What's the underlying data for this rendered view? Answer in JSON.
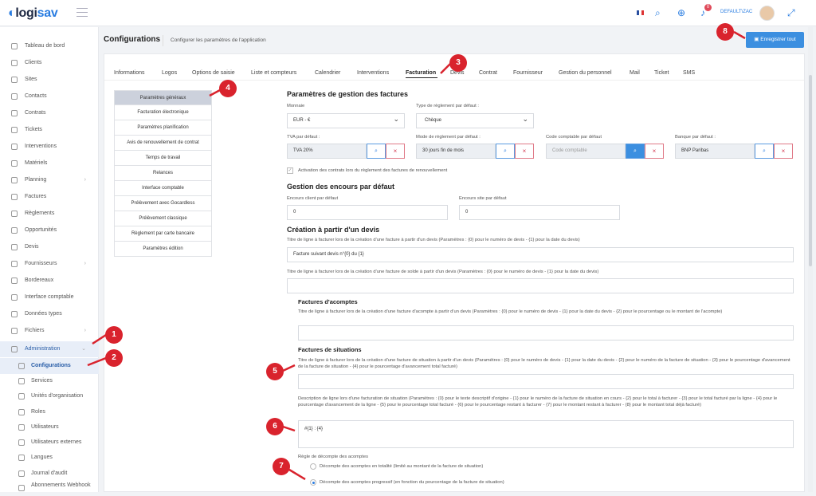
{
  "app": {
    "logo_prefix": "logi",
    "logo_suffix": "sav"
  },
  "topbar": {
    "notification_count": "0",
    "user_label": "DEFAULT\\ZAC"
  },
  "sidebar": {
    "items": [
      {
        "label": "Tableau de bord"
      },
      {
        "label": "Clients"
      },
      {
        "label": "Sites"
      },
      {
        "label": "Contacts"
      },
      {
        "label": "Contrats"
      },
      {
        "label": "Tickets"
      },
      {
        "label": "Interventions"
      },
      {
        "label": "Matériels"
      },
      {
        "label": "Planning"
      },
      {
        "label": "Factures"
      },
      {
        "label": "Règlements"
      },
      {
        "label": "Opportunités"
      },
      {
        "label": "Devis"
      },
      {
        "label": "Fournisseurs"
      },
      {
        "label": "Bordereaux"
      },
      {
        "label": "Interface comptable"
      },
      {
        "label": "Données types"
      },
      {
        "label": "Fichiers"
      },
      {
        "label": "Administration"
      }
    ],
    "sub_items": [
      {
        "label": "Configurations"
      },
      {
        "label": "Services"
      },
      {
        "label": "Unités d'organisation"
      },
      {
        "label": "Roles"
      },
      {
        "label": "Utilisateurs"
      },
      {
        "label": "Utilisateurs externes"
      },
      {
        "label": "Langues"
      },
      {
        "label": "Journal d'audit"
      },
      {
        "label": "Abonnements Webhook"
      }
    ]
  },
  "header": {
    "title": "Configurations",
    "subtitle": "Configurer les paramètres de l'application",
    "save_label": "Enregistrer tout"
  },
  "tabs": [
    "Informations",
    "Logos",
    "Options de saisie",
    "Liste et compteurs",
    "Calendrier",
    "Interventions",
    "Facturation",
    "Devis",
    "Contrat",
    "Fournisseur",
    "Gestion du personnel",
    "Mail",
    "Ticket",
    "SMS"
  ],
  "menu": [
    "Paramètres généraux",
    "Facturation électronique",
    "Paramètres planification",
    "Avis de renouvellement de contrat",
    "Temps de travail",
    "Relances",
    "Interface comptable",
    "Prélèvement avec Gocardless",
    "Prélèvement classique",
    "Règlement par carte bancaire",
    "Paramètres édition"
  ],
  "form": {
    "title": "Paramètres de gestion des factures",
    "monnaie_label": "Monnaie",
    "monnaie_value": "EUR - €",
    "type_reglement_label": "Type de règlement par défaut :",
    "type_reglement_value": "Chèque",
    "tva_label": "TVA par défaut :",
    "tva_value": "TVA 20%",
    "mode_reglement_label": "Mode de règlement par défaut :",
    "mode_reglement_value": "30 jours fin de mois",
    "code_comptable_label": "Code comptable par défaut",
    "code_comptable_placeholder": "Code comptable",
    "banque_label": "Banque par défaut :",
    "banque_value": "BNP Paribas",
    "activation_label": "Activation des contrats lors du règlement des factures de renouvellement",
    "encours_title": "Gestion des encours par défaut",
    "encours_client_label": "Encours client par défaut",
    "encours_client_value": "0",
    "encours_site_label": "Encours site par défaut",
    "encours_site_value": "0",
    "devis_title": "Création à partir d'un devis",
    "devis_ligne_label": "Titre de ligne à facturer lors de la création d'une facture à partir d'un devis (Paramètres : {0} pour le numéro de devis - {1} pour la date du devis)",
    "devis_ligne_value": "Facture suivant devis n°{0} du {1}",
    "solde_label": "Titre de ligne à facturer lors de la création d'une facture de solde à partir d'un devis (Paramètres : {0} pour le numéro de devis - {1} pour la date du devis)",
    "acomptes_title": "Factures d'acomptes",
    "acomptes_label": "Titre de ligne à facturer lors de la création d'une facture d'acompte à partir d'un devis (Paramètres : {0} pour le numéro de devis - {1} pour la date du devis - {2} pour le pourcentage ou le montant de l'acompte)",
    "situations_title": "Factures de situations",
    "situations_label": "Titre de ligne à facturer lors de la création d'une facture de situation à partir d'un devis (Paramètres : {0} pour le numéro de devis - {1} pour la date du devis - {2} pour le numéro de la facture de situation - {3} pour le pourcentage d'avancement de la facture de situation - {4} pour le pourcentage d'avancement total facturé)",
    "description_label": "Description de ligne lors d'une facturation de situation (Paramètres : {0} pour le texte descriptif d'origine - {1} pour le numéro de la facture de situation en cours - {2} pour le total à facturer - {3} pour le total facturé par la ligne - {4} pour le pourcentage d'avancement de la ligne - {5} pour le pourcentage total facturé - {6} pour le pourcentage restant à facturer - {7} pour le montant restant à facturer - {8} pour le montant total déjà facturé)",
    "description_value": "#{1} : {4}",
    "regle_label": "Règle de décompte des acomptes",
    "regle_option1": "Décompte des acomptes en totalité (limité au montant de la facture de situation)",
    "regle_option2": "Décompte des acomptes progressif (en fonction du pourcentage de la facture de situation)"
  },
  "callouts": [
    "1",
    "2",
    "3",
    "4",
    "5",
    "6",
    "7",
    "8"
  ],
  "colors": {
    "accent": "#2a7de1",
    "callout": "#d9232d",
    "save_button": "#3c8fe0"
  }
}
